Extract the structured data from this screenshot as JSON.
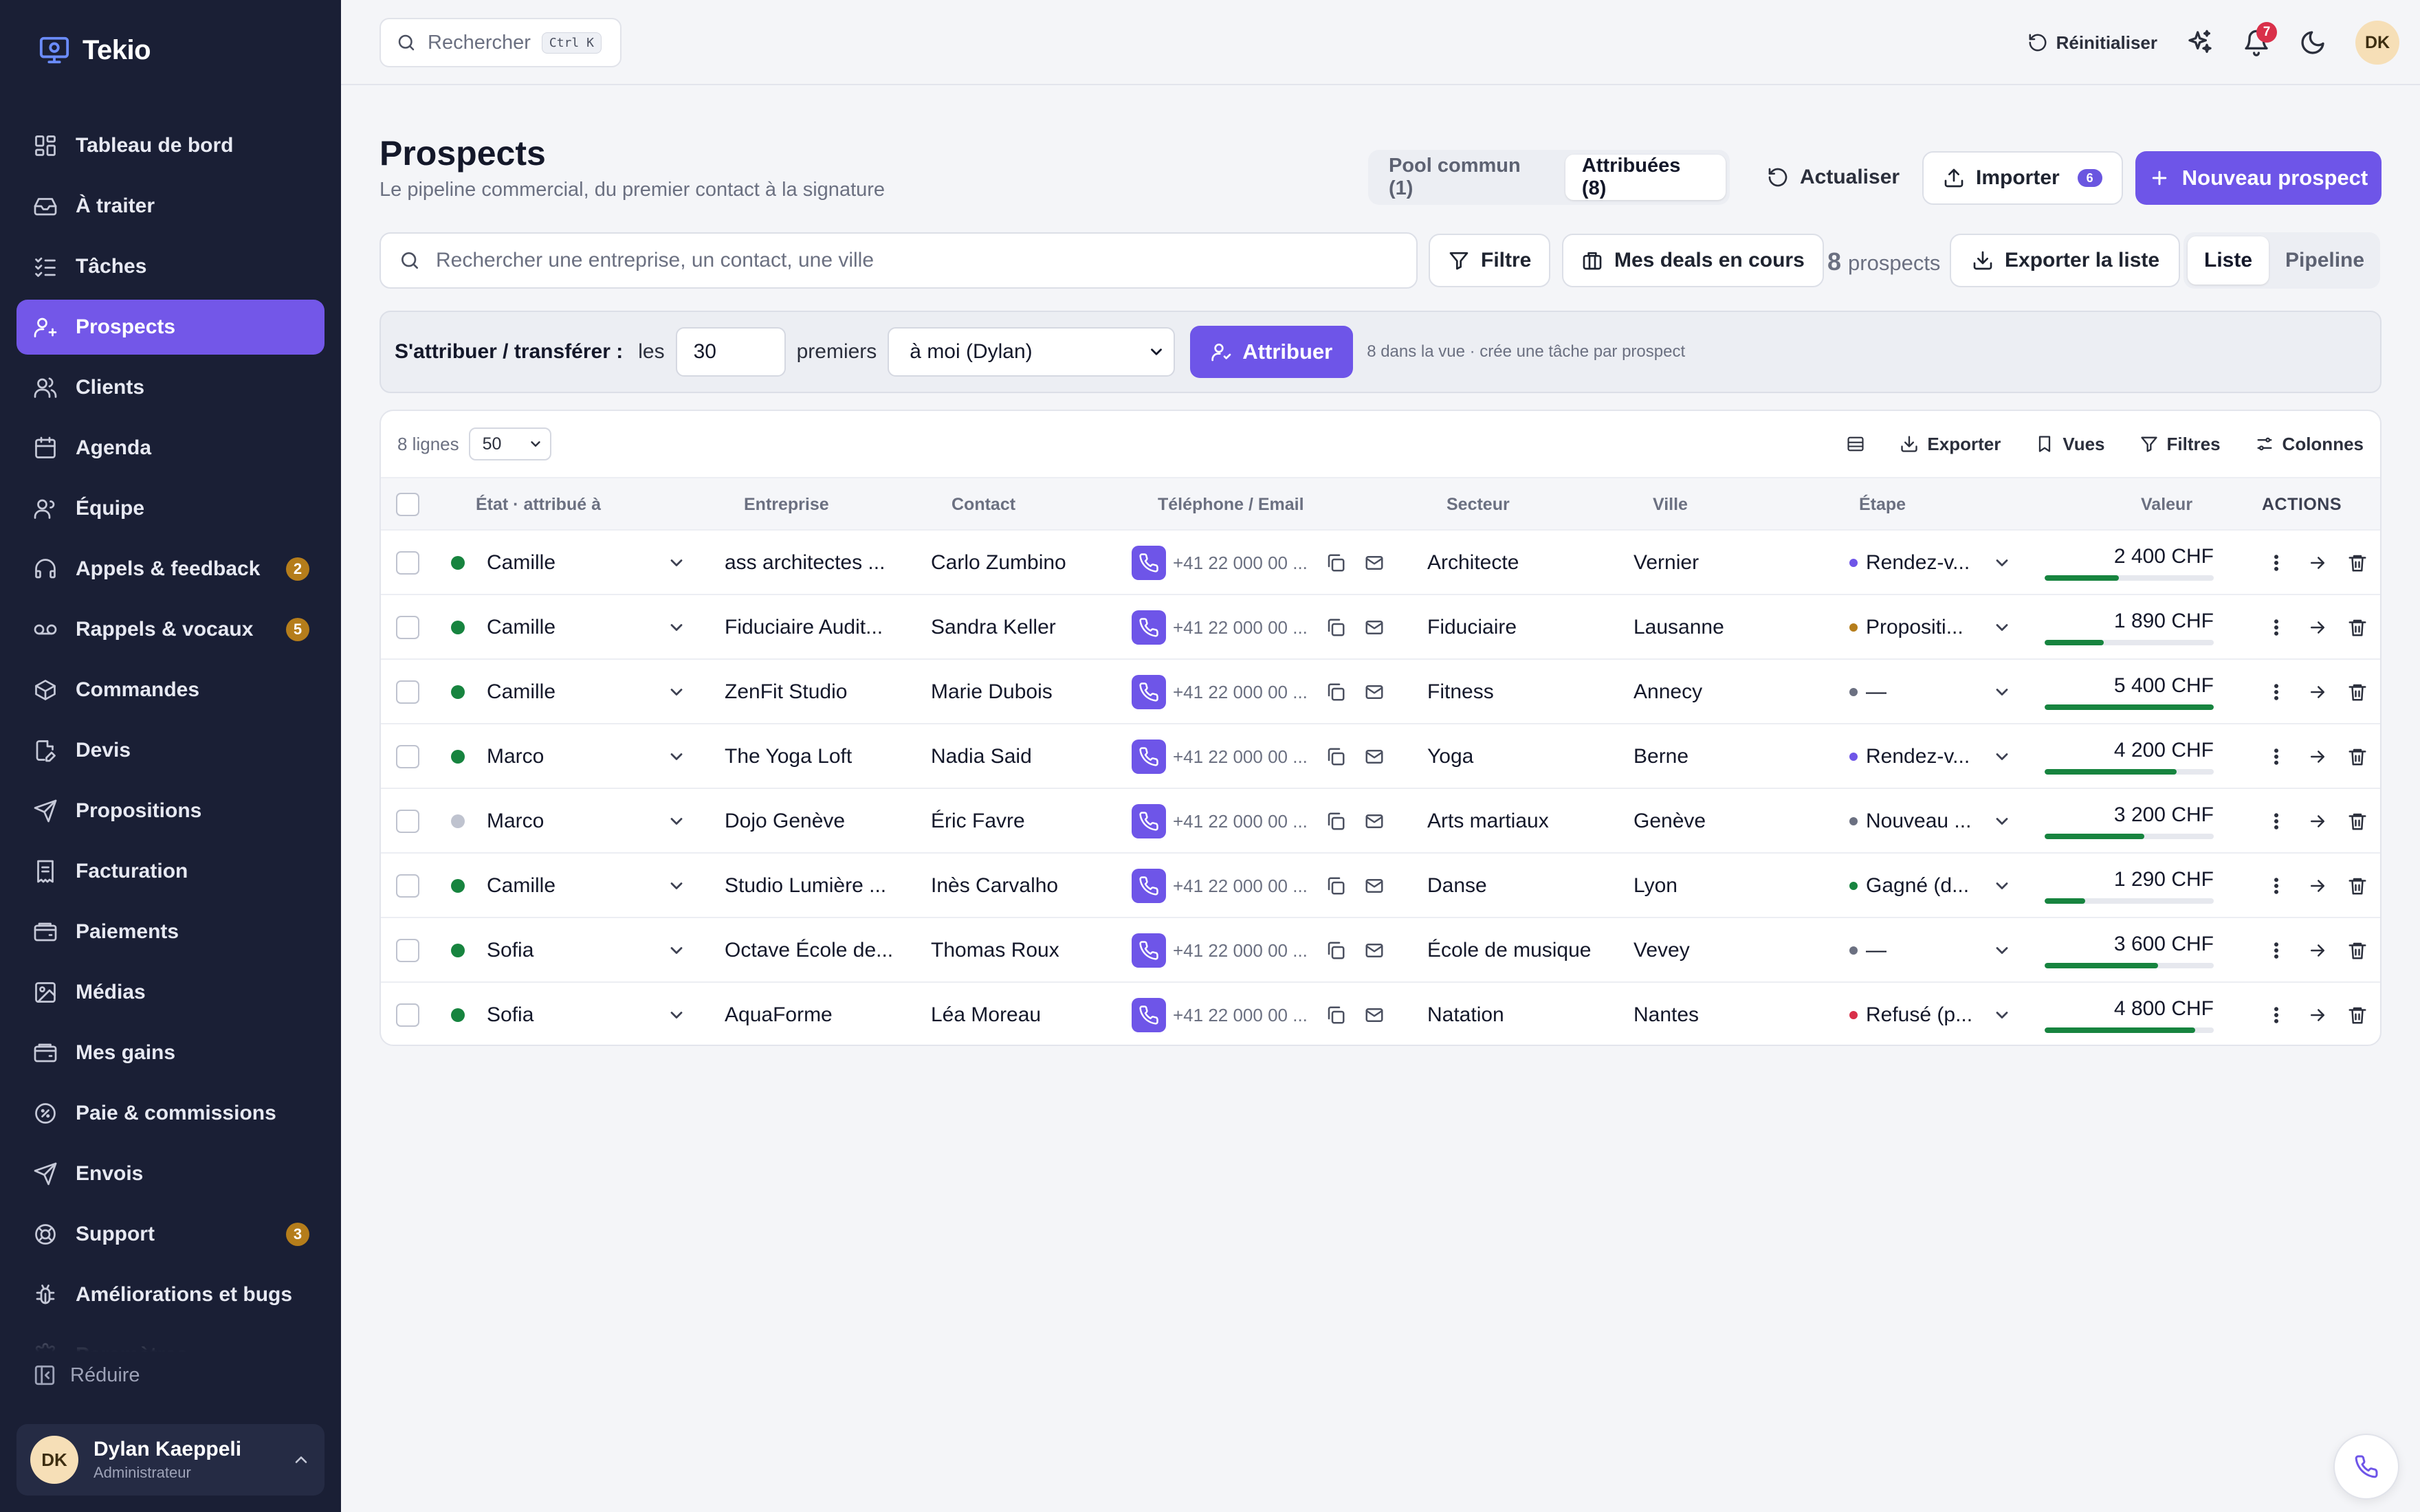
{
  "brand": {
    "name": "Tekio"
  },
  "sidebar": {
    "items": [
      {
        "label": "Tableau de bord",
        "icon": "dashboard-icon"
      },
      {
        "label": "À traiter",
        "icon": "inbox-icon"
      },
      {
        "label": "Tâches",
        "icon": "tasks-icon"
      },
      {
        "label": "Prospects",
        "icon": "user-plus-icon",
        "active": true
      },
      {
        "label": "Clients",
        "icon": "users-icon"
      },
      {
        "label": "Agenda",
        "icon": "calendar-icon"
      },
      {
        "label": "Équipe",
        "icon": "team-icon"
      },
      {
        "label": "Appels & feedback",
        "icon": "headset-icon",
        "badge": "2"
      },
      {
        "label": "Rappels & vocaux",
        "icon": "voicemail-icon",
        "badge": "5"
      },
      {
        "label": "Commandes",
        "icon": "package-icon"
      },
      {
        "label": "Devis",
        "icon": "file-edit-icon"
      },
      {
        "label": "Propositions",
        "icon": "send-icon"
      },
      {
        "label": "Facturation",
        "icon": "receipt-icon"
      },
      {
        "label": "Paiements",
        "icon": "wallet-icon"
      },
      {
        "label": "Médias",
        "icon": "image-icon"
      },
      {
        "label": "Mes gains",
        "icon": "wallet-icon"
      },
      {
        "label": "Paie & commissions",
        "icon": "badge-percent-icon"
      },
      {
        "label": "Envois",
        "icon": "send-icon"
      },
      {
        "label": "Support",
        "icon": "lifebuoy-icon",
        "badge": "3"
      },
      {
        "label": "Améliorations et bugs",
        "icon": "bug-icon"
      },
      {
        "label": "Paramètres",
        "icon": "settings-icon"
      }
    ],
    "collapse_label": "Réduire",
    "user": {
      "initials": "DK",
      "name": "Dylan Kaeppeli",
      "role": "Administrateur"
    }
  },
  "topbar": {
    "search_placeholder": "Rechercher",
    "shortcut": "Ctrl K",
    "reset_label": "Réinitialiser",
    "notifications_count": "7",
    "avatar_initials": "DK"
  },
  "header": {
    "title": "Prospects",
    "subtitle": "Le pipeline commercial, du premier contact à la signature",
    "tabs": [
      {
        "label": "Pool commun (1)",
        "active": false
      },
      {
        "label": "Attribuées (8)",
        "active": true
      }
    ],
    "refresh_label": "Actualiser",
    "import_label": "Importer",
    "import_badge": "6",
    "new_label": "Nouveau prospect"
  },
  "filters": {
    "search_placeholder": "Rechercher une entreprise, un contact, une ville",
    "filter_label": "Filtre",
    "my_deals_label": "Mes deals en cours",
    "count_number": "8",
    "count_label": "prospects",
    "export_list_label": "Exporter la liste",
    "views": [
      {
        "label": "Liste",
        "active": true
      },
      {
        "label": "Pipeline",
        "active": false
      }
    ]
  },
  "assign": {
    "label": "S'attribuer / transférer :",
    "les": "les",
    "count_value": "30",
    "premiers": "premiers",
    "target": "à moi (Dylan)",
    "button": "Attribuer",
    "hint": "8 dans la vue · crée une tâche par prospect"
  },
  "table": {
    "rows_label": "8 lignes",
    "page_size": "50",
    "tools": {
      "export": "Exporter",
      "views": "Vues",
      "filters": "Filtres",
      "columns": "Colonnes"
    },
    "columns": {
      "state": "État · attribué à",
      "company": "Entreprise",
      "contact": "Contact",
      "phone": "Téléphone / Email",
      "sector": "Secteur",
      "city": "Ville",
      "stage": "Étape",
      "value": "Valeur",
      "actions": "ACTIONS"
    },
    "rows": [
      {
        "owner": "Camille",
        "status_color": "#17843f",
        "company": "ass architectes ...",
        "contact": "Carlo Zumbino",
        "phone": "+41 22 000 00 ...",
        "sector": "Architecte",
        "city": "Vernier",
        "stage": "Rendez-v...",
        "stage_color": "#6e55e8",
        "value": "2 400 CHF",
        "progress": 0.44
      },
      {
        "owner": "Camille",
        "status_color": "#17843f",
        "company": "Fiduciaire Audit...",
        "contact": "Sandra Keller",
        "phone": "+41 22 000 00 ...",
        "sector": "Fiduciaire",
        "city": "Lausanne",
        "stage": "Propositi...",
        "stage_color": "#b57d1b",
        "value": "1 890 CHF",
        "progress": 0.35
      },
      {
        "owner": "Camille",
        "status_color": "#17843f",
        "company": "ZenFit Studio",
        "contact": "Marie Dubois",
        "phone": "+41 22 000 00 ...",
        "sector": "Fitness",
        "city": "Annecy",
        "stage": "—",
        "stage_color": "#6b7081",
        "value": "5 400 CHF",
        "progress": 1.0
      },
      {
        "owner": "Marco",
        "status_color": "#17843f",
        "company": "The Yoga Loft",
        "contact": "Nadia Said",
        "phone": "+41 22 000 00 ...",
        "sector": "Yoga",
        "city": "Berne",
        "stage": "Rendez-v...",
        "stage_color": "#6e55e8",
        "value": "4 200 CHF",
        "progress": 0.78
      },
      {
        "owner": "Marco",
        "status_color": "#bfc3cf",
        "company": "Dojo Genève",
        "contact": "Éric Favre",
        "phone": "+41 22 000 00 ...",
        "sector": "Arts martiaux",
        "city": "Genève",
        "stage": "Nouveau ...",
        "stage_color": "#6b7081",
        "value": "3 200 CHF",
        "progress": 0.59
      },
      {
        "owner": "Camille",
        "status_color": "#17843f",
        "company": "Studio Lumière ...",
        "contact": "Inès Carvalho",
        "phone": "+41 22 000 00 ...",
        "sector": "Danse",
        "city": "Lyon",
        "stage": "Gagné (d...",
        "stage_color": "#17843f",
        "value": "1 290 CHF",
        "progress": 0.24
      },
      {
        "owner": "Sofia",
        "status_color": "#17843f",
        "company": "Octave École de...",
        "contact": "Thomas Roux",
        "phone": "+41 22 000 00 ...",
        "sector": "École de musique",
        "city": "Vevey",
        "stage": "—",
        "stage_color": "#6b7081",
        "value": "3 600 CHF",
        "progress": 0.67
      },
      {
        "owner": "Sofia",
        "status_color": "#17843f",
        "company": "AquaForme",
        "contact": "Léa Moreau",
        "phone": "+41 22 000 00 ...",
        "sector": "Natation",
        "city": "Nantes",
        "stage": "Refusé (p...",
        "stage_color": "#d9304a",
        "value": "4 800 CHF",
        "progress": 0.89
      }
    ]
  },
  "colors": {
    "accent": "#6e55e8",
    "sidebar_bg": "#1a1f35",
    "success": "#17843f",
    "danger": "#d9304a"
  }
}
